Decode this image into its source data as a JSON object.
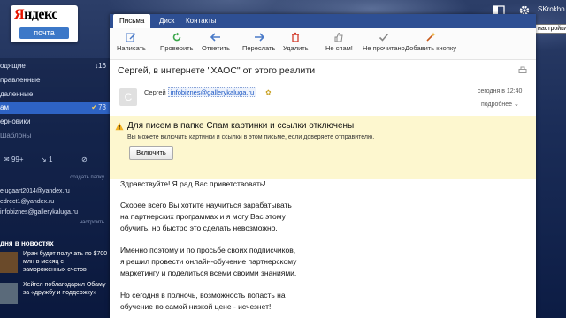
{
  "logo": {
    "text": "Яндекс",
    "first_letter": "Я",
    "rest": "ндекс",
    "service": "почта"
  },
  "header": {
    "user": "SKrokhn",
    "tooltip": "Все настройки"
  },
  "sidebar": {
    "folders": [
      {
        "label": "одящие",
        "count": "↓16"
      },
      {
        "label": "правленные",
        "count": ""
      },
      {
        "label": "даленные",
        "count": ""
      },
      {
        "label": "ам",
        "count": "73"
      },
      {
        "label": "ерновики",
        "count": ""
      },
      {
        "label": "Шаблоны",
        "count": ""
      }
    ],
    "filters": {
      "unread": "99+",
      "flagged": "1",
      "attachments": ""
    },
    "clean_link": "создать папку",
    "contacts": [
      "elugaart2014@yandex.ru",
      "edrect1@yandex.ru",
      "infobiznes@gallerykaluga.ru"
    ],
    "contacts_link": "настроить",
    "news_title": "дня в новостях",
    "news": [
      {
        "text": "Иран будет получать по $700 млн в месяц с замороженных счетов"
      },
      {
        "text": "Хейгел побла­годарил Обаму за «дружбу и поддержку»"
      }
    ]
  },
  "tabs": [
    {
      "label": "Письма"
    },
    {
      "label": "Диск"
    },
    {
      "label": "Контакты"
    }
  ],
  "toolbar": {
    "compose": "Написать",
    "check": "Проверить",
    "reply": "Ответить",
    "forward": "Переслать",
    "delete": "Удалить",
    "not_spam": "Не спам!",
    "not_read": "Не прочитано",
    "add_button": "Добавить кнопку"
  },
  "message": {
    "subject": "Сергей, в интернете \"ХАОС\" от этого реалити",
    "avatar_letter": "С",
    "sender_name": "Сергей",
    "sender_addr": "infobiznes@gallerykaluga.ru",
    "time": "сегодня в 12:40",
    "more": "подробнее",
    "warning_title": "Для писем в папке Спам картинки и ссылки отключены",
    "warning_desc": "Вы можете включить картинки и ссылки в этом письме, если доверяете отправителю.",
    "enable_button": "Включить",
    "body": [
      "Здравствуйте! Я рад Вас приветствовать!",
      "",
      "Скорее всего Вы хотите научиться зарабатывать",
      "на партнерских программах и я могу Вас этому",
      "обучить, но быстро это сделать невозможно.",
      "",
      "Именно поэтому и по просьбе своих подписчиков,",
      "я решил провести онлайн-обучение партнерскому",
      "маркетингу и поделиться всеми своими знаниями.",
      "",
      "Но сегодня в полночь, возможность попасть на",
      "обучение по самой низкой цене - исчезнет!"
    ]
  },
  "colors": {
    "tab_bar": "#2e4f93",
    "active_folder": "#2e63c4",
    "warning_bg": "#fdf7cf",
    "link": "#1a56c4"
  }
}
